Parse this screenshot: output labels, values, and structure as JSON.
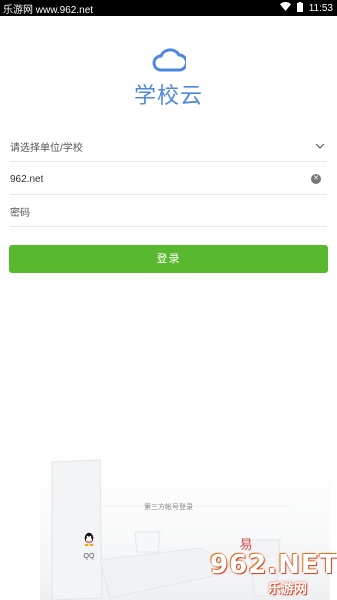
{
  "status_bar": {
    "left_text": "乐游网 www.962.net",
    "time": "11:53"
  },
  "logo": {
    "name": "学校云",
    "icon": "cloud-icon",
    "color": "#4c87e0"
  },
  "form": {
    "school_placeholder": "请选择单位/学校",
    "account_value": "962.net",
    "password_placeholder": "密码"
  },
  "login_button": {
    "label": "登录",
    "color": "#58b82e"
  },
  "third_party": {
    "label": "第三方帐号登录",
    "qq_label": "QQ",
    "yi_label": "易"
  },
  "watermark": {
    "main": "962.NET",
    "sub": "乐游网"
  }
}
